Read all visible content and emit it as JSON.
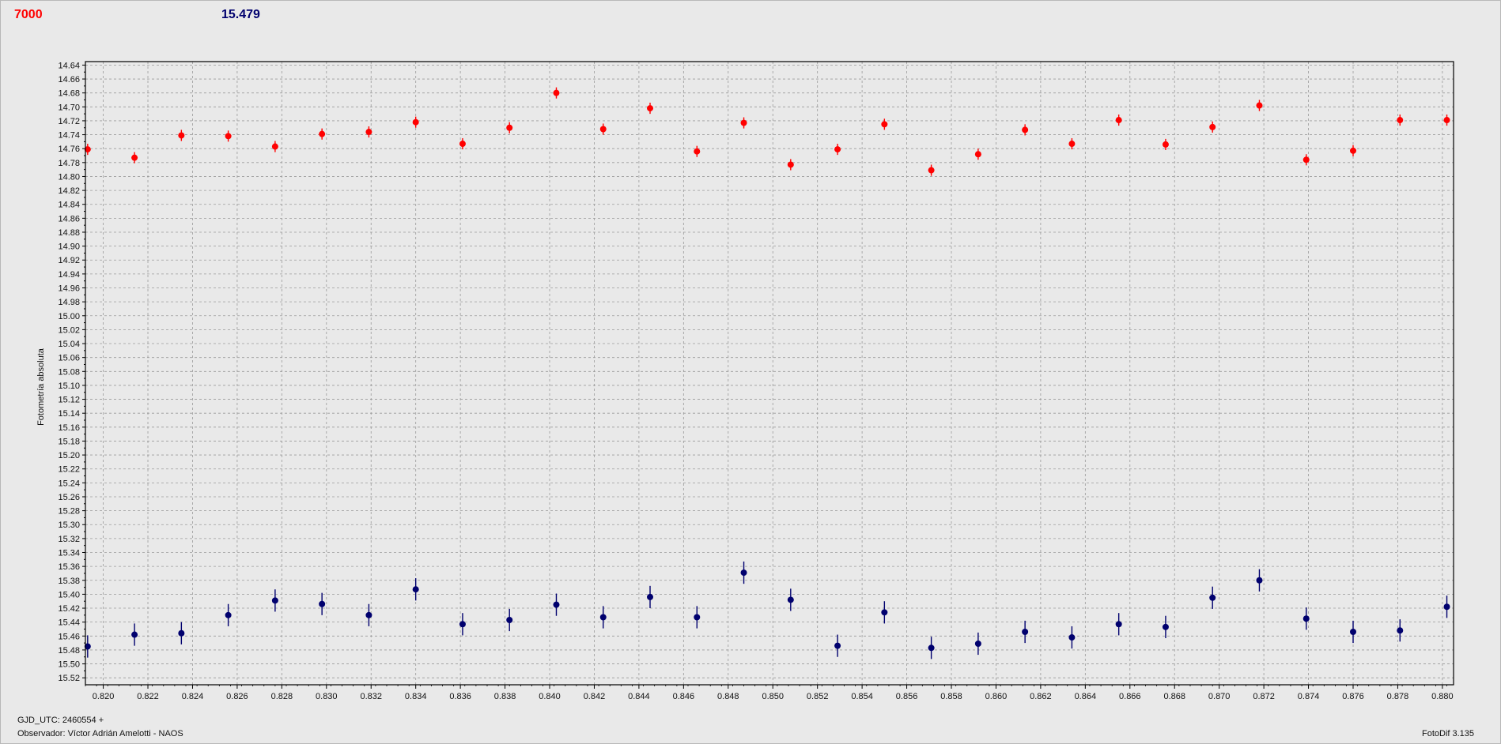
{
  "header": {
    "red_value": "7000",
    "blue_value": "15.479"
  },
  "footer": {
    "jd_label": "GJD_UTC: 2460554 +",
    "observer": "Observador: Víctor Adrián Amelotti - NAOS",
    "version": "FotoDif 3.135"
  },
  "colors": {
    "red": "#ff0000",
    "blue": "#00006e",
    "grid": "#9a9a9a",
    "plot_bg": "#e9e9e9"
  },
  "chart_data": {
    "type": "scatter",
    "ylabel": "Fotometría absoluta",
    "xlabel": "",
    "xlim": [
      0.8192,
      0.8805
    ],
    "ylim": [
      15.53,
      14.635
    ],
    "y_inverted": true,
    "grid": true,
    "x_ticks": [
      "0.820",
      "0.822",
      "0.824",
      "0.826",
      "0.828",
      "0.830",
      "0.832",
      "0.834",
      "0.836",
      "0.838",
      "0.840",
      "0.842",
      "0.844",
      "0.846",
      "0.848",
      "0.850",
      "0.852",
      "0.854",
      "0.856",
      "0.858",
      "0.860",
      "0.862",
      "0.864",
      "0.866",
      "0.868",
      "0.870",
      "0.872",
      "0.874",
      "0.876",
      "0.878",
      "0.880"
    ],
    "y_ticks": [
      "14.64",
      "14.66",
      "14.68",
      "14.70",
      "14.72",
      "14.74",
      "14.76",
      "14.78",
      "14.80",
      "14.82",
      "14.84",
      "14.86",
      "14.88",
      "14.90",
      "14.92",
      "14.94",
      "14.96",
      "14.98",
      "15.00",
      "15.02",
      "15.04",
      "15.06",
      "15.08",
      "15.10",
      "15.12",
      "15.14",
      "15.16",
      "15.18",
      "15.20",
      "15.22",
      "15.24",
      "15.26",
      "15.28",
      "15.30",
      "15.32",
      "15.34",
      "15.36",
      "15.38",
      "15.40",
      "15.42",
      "15.44",
      "15.46",
      "15.48",
      "15.50",
      "15.52"
    ],
    "x": [
      0.8193,
      0.8214,
      0.8235,
      0.8256,
      0.8277,
      0.8298,
      0.8319,
      0.834,
      0.8361,
      0.8382,
      0.8403,
      0.8424,
      0.8445,
      0.8466,
      0.8487,
      0.8508,
      0.8529,
      0.855,
      0.8571,
      0.8592,
      0.8613,
      0.8634,
      0.8655,
      0.8676,
      0.8697,
      0.8718,
      0.8739,
      0.876,
      0.8781,
      0.8802
    ],
    "series": [
      {
        "color": "red",
        "values": [
          14.761,
          14.773,
          14.741,
          14.742,
          14.757,
          14.739,
          14.736,
          14.722,
          14.753,
          14.73,
          14.68,
          14.732,
          14.702,
          14.764,
          14.723,
          14.783,
          14.761,
          14.725,
          14.791,
          14.768,
          14.733,
          14.753,
          14.719,
          14.754,
          14.729,
          14.698,
          14.776,
          14.763,
          14.719,
          14.719
        ],
        "errors": [
          0.008,
          0.008,
          0.008,
          0.008,
          0.008,
          0.008,
          0.008,
          0.008,
          0.008,
          0.008,
          0.008,
          0.008,
          0.008,
          0.008,
          0.008,
          0.008,
          0.008,
          0.008,
          0.008,
          0.008,
          0.008,
          0.008,
          0.008,
          0.008,
          0.008,
          0.008,
          0.008,
          0.008,
          0.008,
          0.008
        ]
      },
      {
        "color": "blue",
        "values": [
          15.475,
          15.458,
          15.456,
          15.43,
          15.409,
          15.414,
          15.43,
          15.393,
          15.443,
          15.437,
          15.415,
          15.433,
          15.404,
          15.433,
          15.369,
          15.408,
          15.474,
          15.426,
          15.477,
          15.471,
          15.454,
          15.462,
          15.443,
          15.447,
          15.405,
          15.38,
          15.435,
          15.454,
          15.452,
          15.418
        ],
        "errors": [
          0.016,
          0.016,
          0.016,
          0.016,
          0.016,
          0.016,
          0.016,
          0.016,
          0.016,
          0.016,
          0.016,
          0.016,
          0.016,
          0.016,
          0.016,
          0.016,
          0.016,
          0.016,
          0.016,
          0.016,
          0.016,
          0.016,
          0.016,
          0.016,
          0.016,
          0.016,
          0.016,
          0.016,
          0.016,
          0.016
        ]
      }
    ]
  }
}
